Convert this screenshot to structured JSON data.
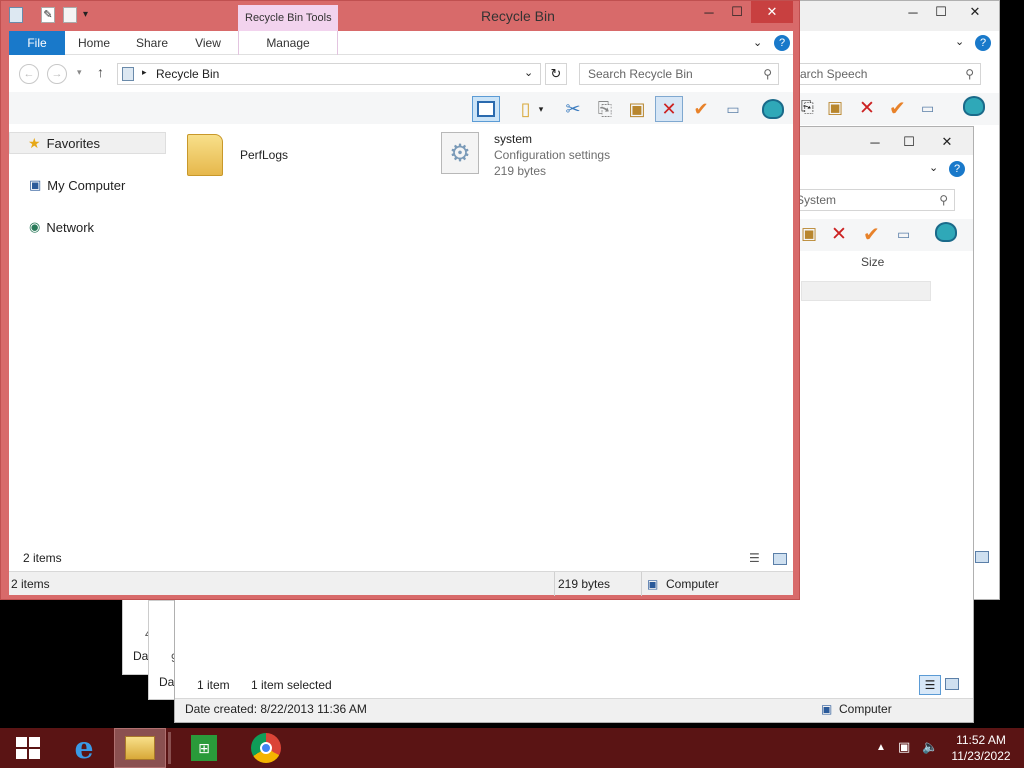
{
  "main_window": {
    "title": "Recycle Bin",
    "contextual_tab": "Recycle Bin Tools",
    "ribbon_tabs": [
      "File",
      "Home",
      "Share",
      "View",
      "Manage"
    ],
    "address": "Recycle Bin",
    "search_placeholder": "Search Recycle Bin",
    "nav": {
      "favorites": "Favorites",
      "my_computer": "My Computer",
      "network": "Network"
    },
    "files": [
      {
        "name": "PerfLogs",
        "type": "",
        "size": ""
      },
      {
        "name": "system",
        "type": "Configuration settings",
        "size": "219 bytes"
      }
    ],
    "count_label": "2 items",
    "status": {
      "items": "2 items",
      "size": "219 bytes",
      "location": "Computer"
    }
  },
  "bg_window_1": {
    "search_placeholder": "arch Speech"
  },
  "bg_window_2": {
    "search_placeholder": "System",
    "column_size": "Size",
    "count_label": "1 item",
    "selected_label": "1 item selected",
    "date_created": "Date created: 8/22/2013 11:36 AM",
    "location": "Computer"
  },
  "bg_fragments": {
    "digit_a": "4",
    "digit_b": "9",
    "dat": "Dat"
  },
  "taskbar": {
    "time": "11:52 AM",
    "date": "11/23/2022"
  },
  "colors": {
    "accent_title": "#d86a6a",
    "file_tab": "#1979ca",
    "taskbar": "#5a1414",
    "contextual_tab": "#f2d3ee"
  }
}
